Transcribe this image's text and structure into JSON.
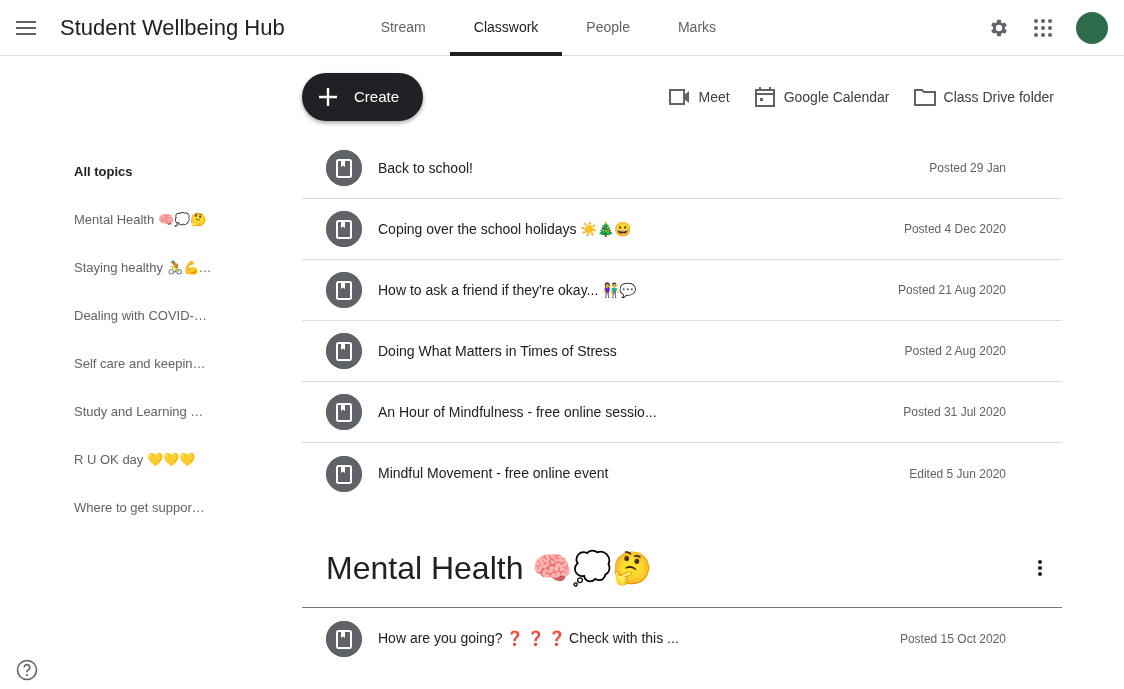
{
  "app_bar": {
    "title": "Student Wellbeing Hub",
    "tabs": [
      {
        "label": "Stream",
        "selected": false
      },
      {
        "label": "Classwork",
        "selected": true
      },
      {
        "label": "People",
        "selected": false
      },
      {
        "label": "Marks",
        "selected": false
      }
    ]
  },
  "toolbar": {
    "create_label": "Create",
    "links": [
      {
        "kind": "video",
        "label": "Meet"
      },
      {
        "kind": "calendar",
        "label": "Google Calendar"
      },
      {
        "kind": "folder",
        "label": "Class Drive folder"
      }
    ]
  },
  "topics": [
    {
      "label": "All topics",
      "selected": true
    },
    {
      "label": "Mental Health 🧠💭🤔",
      "selected": false
    },
    {
      "label": "Staying healthy 🚴💪…",
      "selected": false
    },
    {
      "label": "Dealing with COVID-…",
      "selected": false
    },
    {
      "label": "Self care and keepin…",
      "selected": false
    },
    {
      "label": "Study and Learning …",
      "selected": false
    },
    {
      "label": "R U OK day 💛💛💛",
      "selected": false
    },
    {
      "label": "Where to get suppor…",
      "selected": false
    }
  ],
  "materials": [
    {
      "title": "Back to school!",
      "date": "Posted 29 Jan"
    },
    {
      "title": "Coping over the school holidays ☀️🎄😀",
      "date": "Posted 4 Dec 2020"
    },
    {
      "title": "How to ask a friend if they're okay... 👫💬",
      "date": "Posted 21 Aug 2020"
    },
    {
      "title": "Doing What Matters in Times of Stress",
      "date": "Posted 2 Aug 2020"
    },
    {
      "title": "An Hour of Mindfulness - free online sessio...",
      "date": "Posted 31 Jul 2020"
    },
    {
      "title": "Mindful Movement - free online event",
      "date": "Edited 5 Jun 2020"
    }
  ],
  "sections": [
    {
      "heading": "Mental Health 🧠💭🤔",
      "materials": [
        {
          "title": "How are you going? ❓ ❓ ❓ Check with this ...",
          "date": "Posted 15 Oct 2020"
        }
      ]
    }
  ]
}
